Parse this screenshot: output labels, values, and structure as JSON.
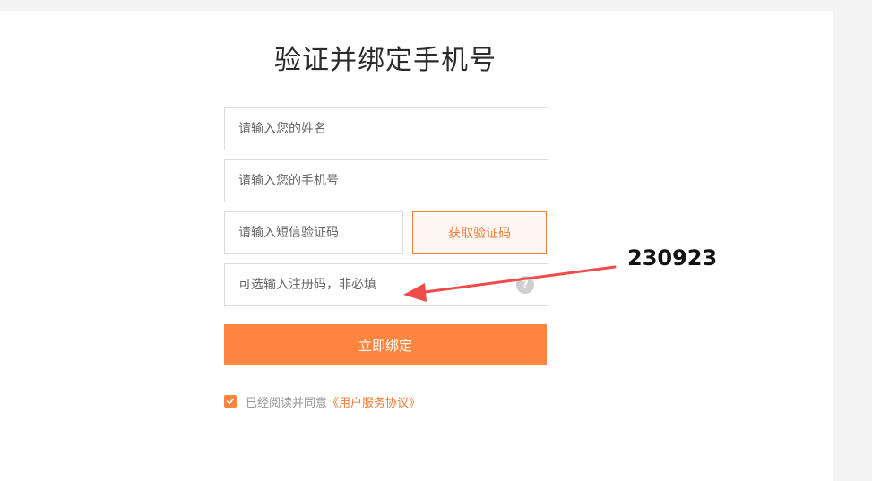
{
  "page": {
    "title": "验证并绑定手机号"
  },
  "form": {
    "name_placeholder": "请输入您的姓名",
    "phone_placeholder": "请输入您的手机号",
    "sms_placeholder": "请输入短信验证码",
    "sms_button_label": "获取验证码",
    "code_placeholder": "可选输入注册码，非必填",
    "help_icon_glyph": "?",
    "submit_label": "立即绑定",
    "agree_text": "已经阅读并同意",
    "agree_link": "《用户服务协议》",
    "agree_checked": true
  },
  "annotation": {
    "text": "230923",
    "arrow_color": "#f04a4a"
  },
  "colors": {
    "accent": "#ff8540",
    "accent_dark": "#f07d3a"
  }
}
